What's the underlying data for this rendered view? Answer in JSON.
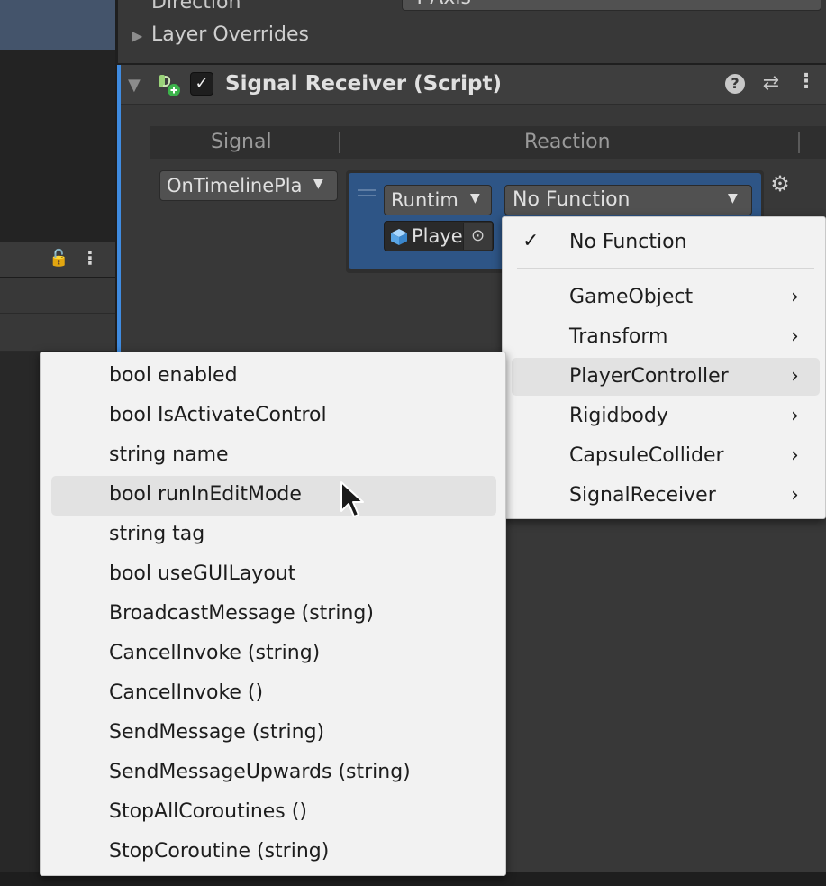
{
  "inspector": {
    "direction_label": "Direction",
    "direction_value": "Y-Axis",
    "layer_overrides": "Layer Overrides",
    "component_title": "Signal Receiver (Script)",
    "checkbox_mark": "✓",
    "help_glyph": "?",
    "preset_glyph": "⇄",
    "kebab_glyph": "⋮"
  },
  "table": {
    "col_signal": "Signal",
    "col_reaction": "Reaction",
    "signal_value": "OnTimelinePla",
    "runtime_value": "Runtim",
    "function_value": "No Function",
    "object_value": "Playe",
    "picker_glyph": "⊙",
    "gear_glyph": "⚙"
  },
  "left_panel": {
    "lock_glyph": "🔓",
    "kebab_glyph": "⋮"
  },
  "function_menu": {
    "check_glyph": "✓",
    "chevron_glyph": "›",
    "selected": "No Function",
    "items": [
      "GameObject",
      "Transform",
      "PlayerController",
      "Rigidbody",
      "CapsuleCollider",
      "SignalReceiver"
    ],
    "hovered": "PlayerController"
  },
  "member_menu": {
    "hovered": "bool runInEditMode",
    "items": [
      "bool enabled",
      "bool IsActivateControl",
      "string name",
      "bool runInEditMode",
      "string tag",
      "bool useGUILayout",
      "BroadcastMessage (string)",
      "CancelInvoke (string)",
      "CancelInvoke ()",
      "SendMessage (string)",
      "SendMessageUpwards (string)",
      "StopAllCoroutines ()",
      "StopCoroutine (string)"
    ]
  },
  "colors": {
    "accent": "#3f8be0",
    "reaction_row": "#2e5586",
    "menu_bg": "#f2f2f2"
  }
}
